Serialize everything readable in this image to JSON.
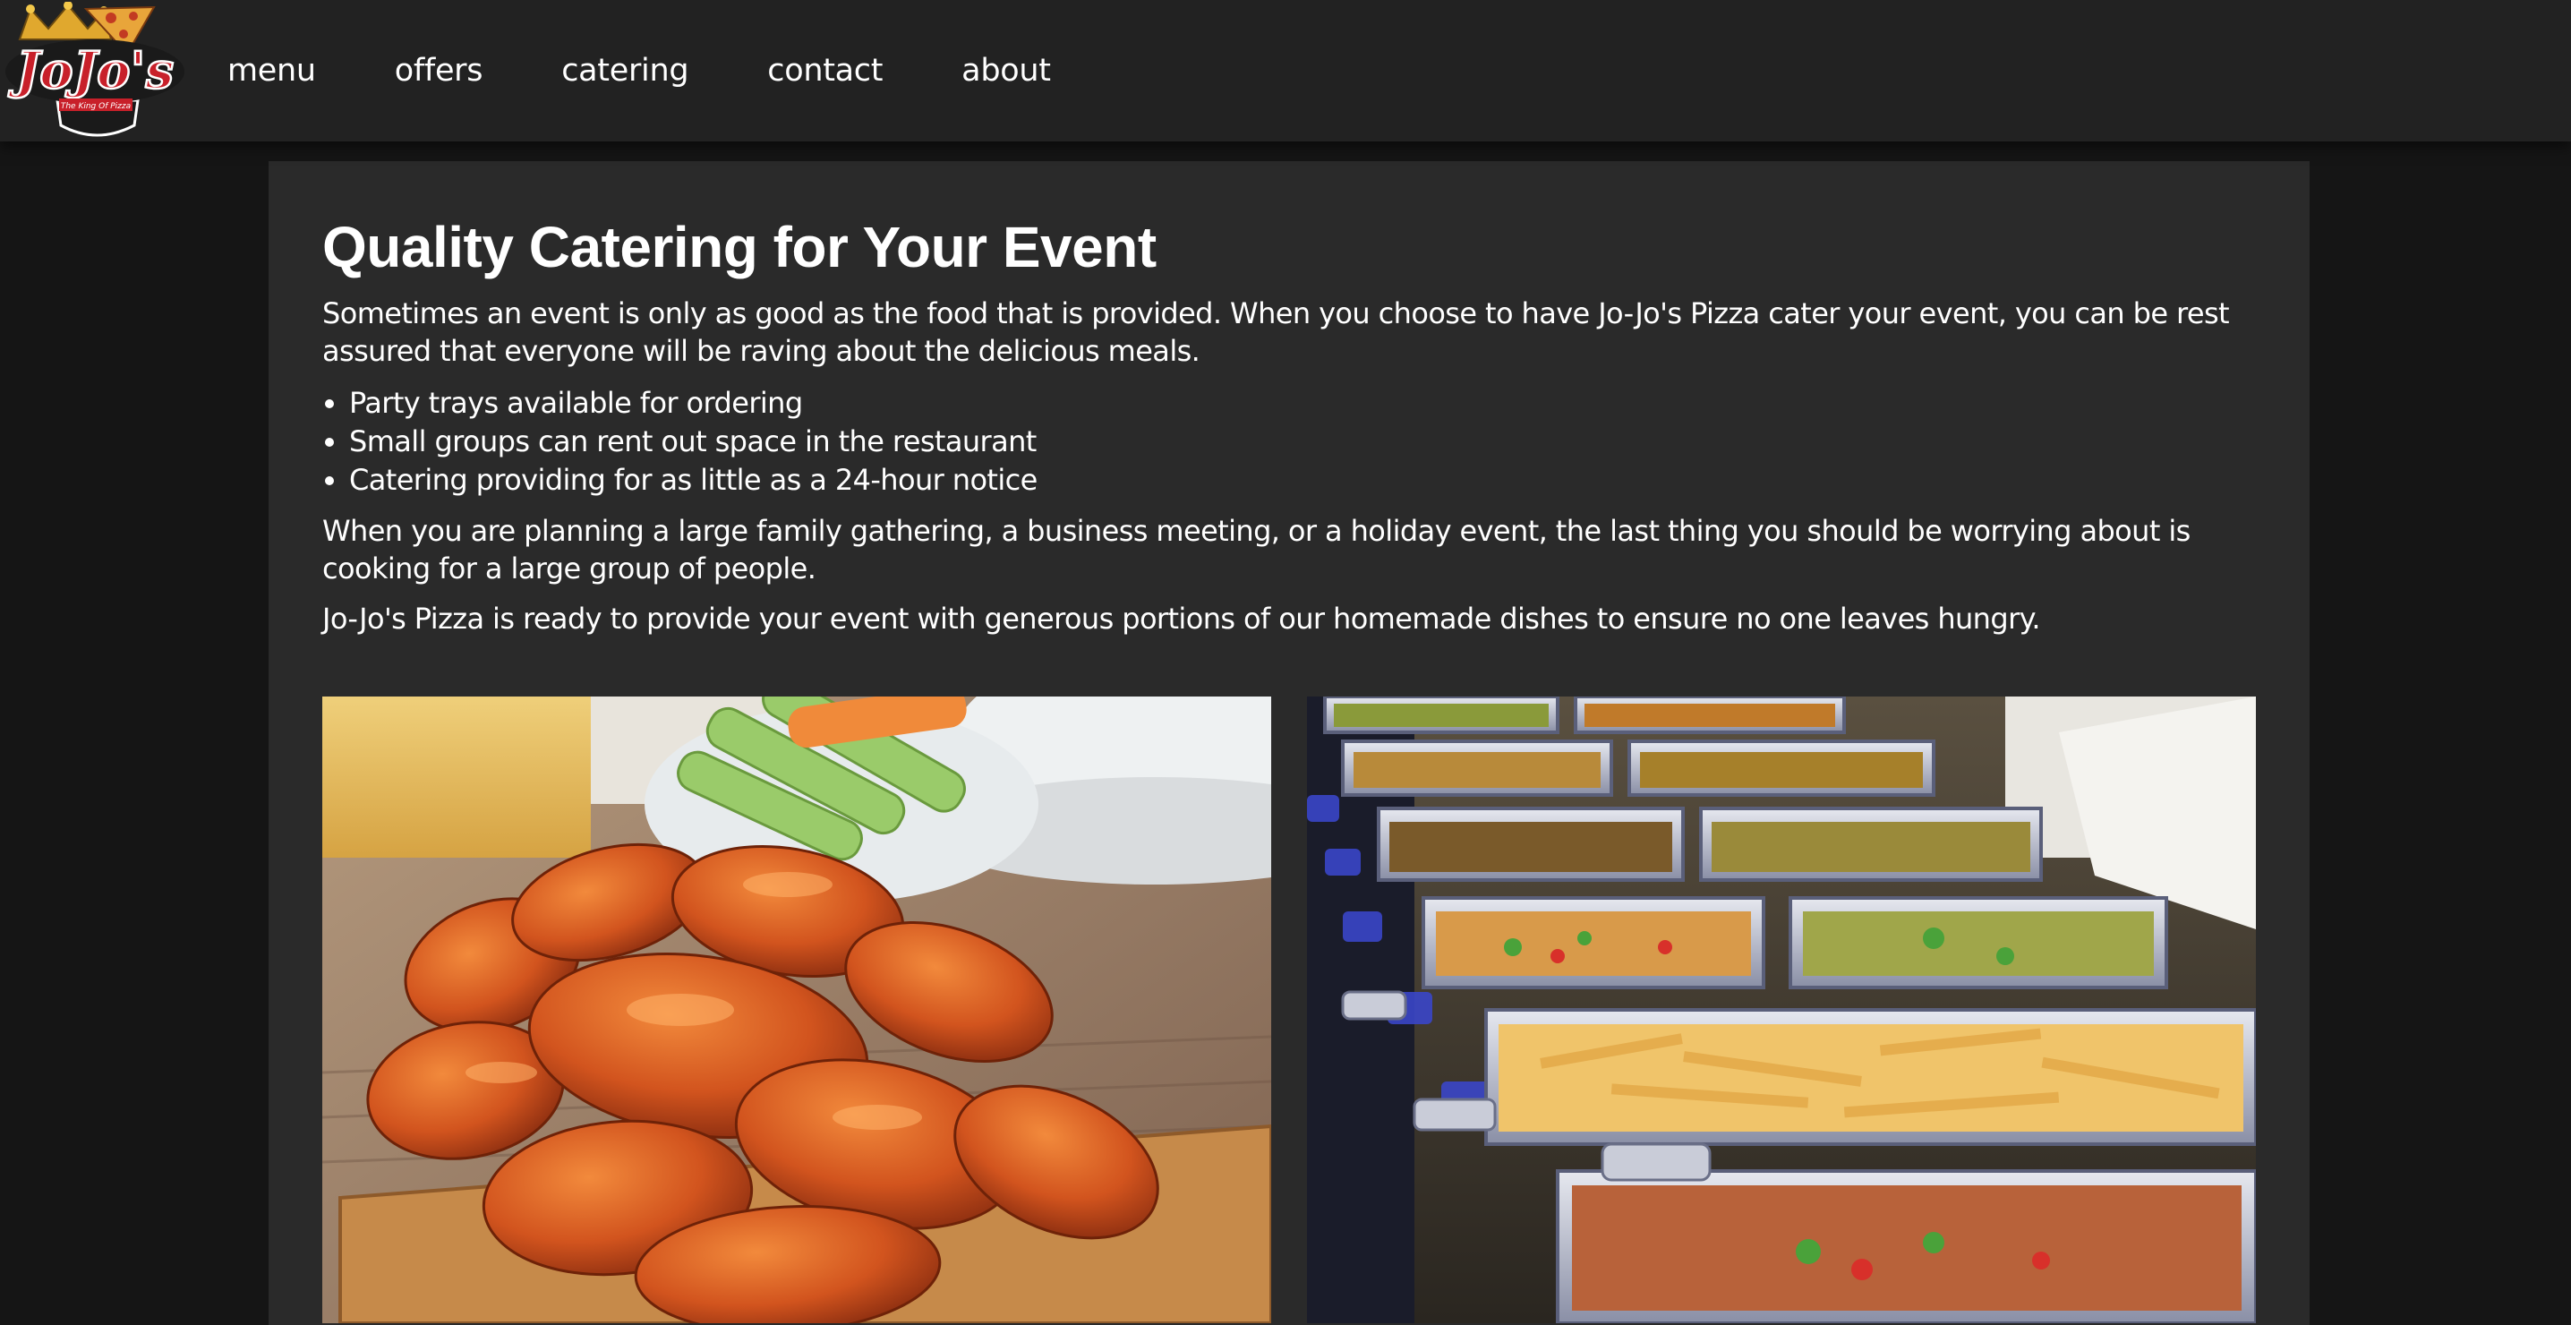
{
  "brand": {
    "logo_text": "JoJo's",
    "logo_tagline": "The King Of Pizza"
  },
  "nav": {
    "items": [
      {
        "label": "menu"
      },
      {
        "label": "offers"
      },
      {
        "label": "catering"
      },
      {
        "label": "contact"
      },
      {
        "label": "about"
      }
    ]
  },
  "main": {
    "title": "Quality Catering for Your Event",
    "intro": "Sometimes an event is only as good as the food that is provided. When you choose to have Jo-Jo's Pizza cater your event, you can be rest assured that everyone will be raving about the delicious meals.",
    "bullets": [
      "Party trays available for ordering",
      "Small groups can rent out space in the restaurant",
      "Catering providing for as little as a 24-hour notice"
    ],
    "paragraph_2": "When you are planning a large family gathering, a business meeting, or a holiday event, the last thing you should be worrying about is cooking for a large group of people.",
    "paragraph_3": "Jo-Jo's Pizza is ready to provide your event with generous portions of our homemade dishes to ensure no one leaves hungry."
  },
  "colors": {
    "nav_bg": "#222222",
    "page_bg": "#151515",
    "panel_bg": "#2a2a2a",
    "text": "#ffffff",
    "logo_red": "#c8202a",
    "logo_gold": "#e0a82e"
  },
  "images": [
    {
      "name": "buffalo-wings-photo"
    },
    {
      "name": "catering-buffet-photo"
    }
  ]
}
